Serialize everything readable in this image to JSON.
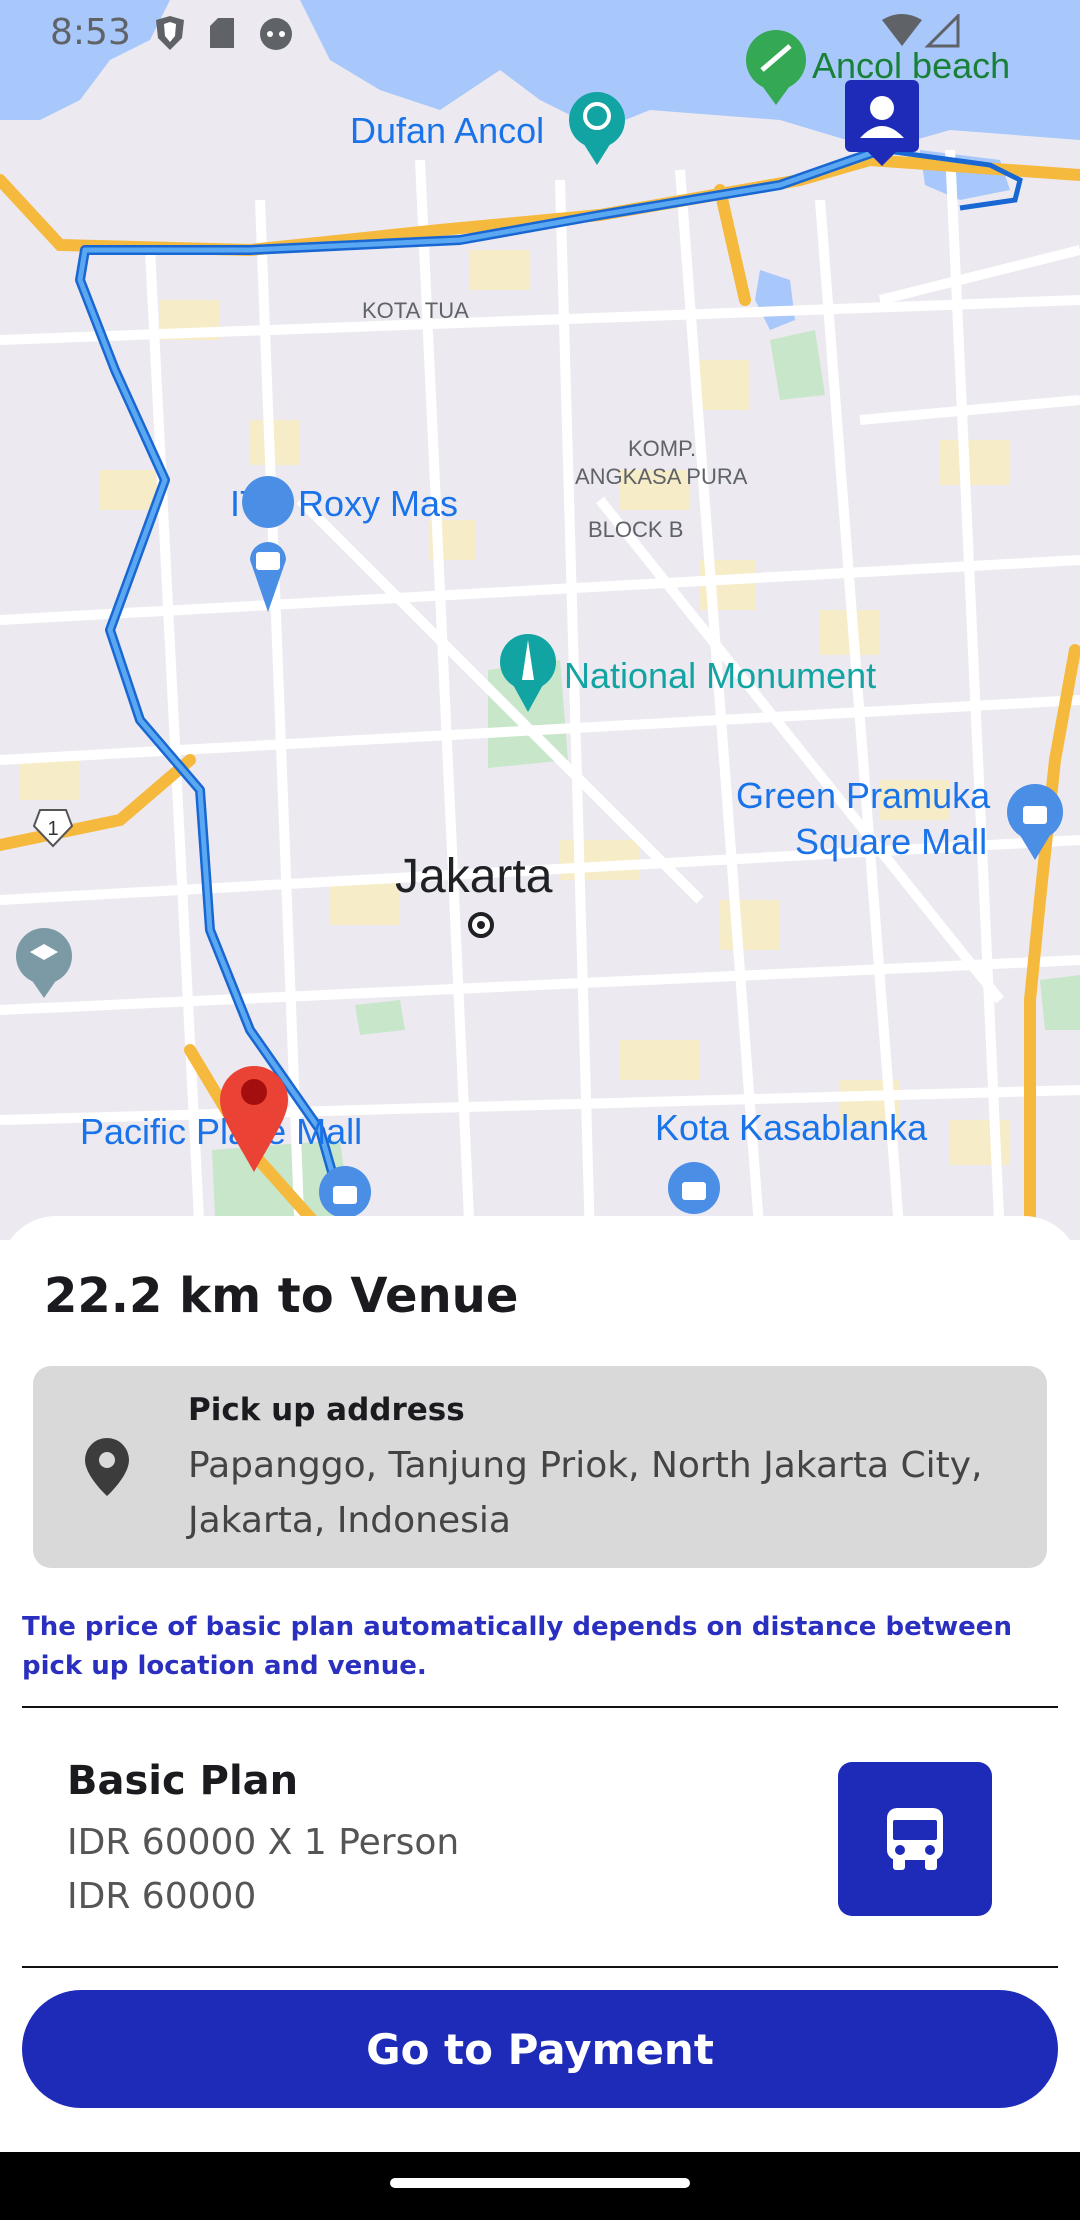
{
  "status_bar": {
    "time": "8:53"
  },
  "map": {
    "places": {
      "ancol_beach": "Ancol beach",
      "dufan_ancol": "Dufan Ancol",
      "kota_tua": "KOTA TUA",
      "komp": "KOMP.",
      "angkasa_pura": "ANGKASA PURA",
      "block_b": "BLOCK B",
      "itc_roxy_mas": "ITC Roxy Mas",
      "national_monument": "National Monument",
      "green_pramuka_1": "Green Pramuka",
      "green_pramuka_2": "Square Mall",
      "jakarta": "Jakarta",
      "pacific_place": "Pacific Place Mall",
      "kota_kasablanka": "Kota Kasablanka",
      "road_shield": "1"
    },
    "colors": {
      "route": "#3a8fde",
      "land": "#eceaf0",
      "water": "#a8c7fa",
      "park": "#c8e6c9",
      "place_text": "#1a73e8",
      "poi_green": "#188038",
      "destination_pin": "#ea4335"
    }
  },
  "sheet": {
    "distance_title": "22.2 km to Venue",
    "pickup": {
      "label": "Pick up address",
      "address": "Papanggo, Tanjung Priok, North Jakarta City, Jakarta, Indonesia"
    },
    "price_note": "The price of basic plan automatically depends on distance between pick up location and venue.",
    "plan": {
      "title": "Basic Plan",
      "calc": "IDR 60000 X 1 Person",
      "total": "IDR 60000"
    },
    "pay_button": "Go to Payment"
  },
  "colors": {
    "primary": "#1e2ab8",
    "card_bg": "#d9d9d9",
    "note_text": "#2a2fbf"
  },
  "icons": {
    "pickup": "location-pin-icon",
    "plan": "bus-icon",
    "user_marker": "person-icon"
  }
}
